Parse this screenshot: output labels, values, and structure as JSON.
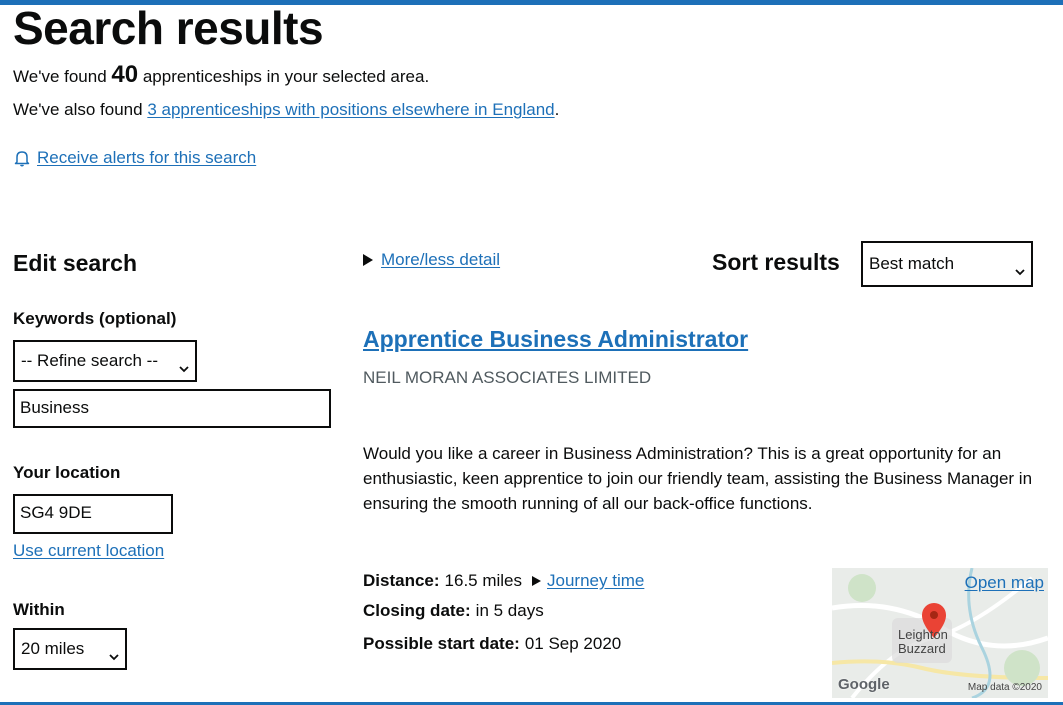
{
  "header": {
    "title": "Search results",
    "found_prefix": "We've found",
    "found_count": "40",
    "found_suffix": "apprenticeships in your selected area.",
    "also_prefix": "We've also found",
    "also_link": "3 apprenticeships with positions elsewhere in England",
    "also_suffix": ".",
    "alerts_link": "Receive alerts for this search",
    "alerts_icon": "bell-icon"
  },
  "sidebar": {
    "heading": "Edit search",
    "keywords_label": "Keywords (optional)",
    "refine_select_value": "-- Refine search --",
    "keywords_value": "Business",
    "location_label": "Your location",
    "location_value": "SG4 9DE",
    "use_location_link": "Use current location",
    "within_label": "Within",
    "within_value": "20 miles"
  },
  "results": {
    "details_toggle": "More/less detail",
    "sort_label": "Sort results",
    "sort_value": "Best match",
    "items": [
      {
        "title": "Apprentice Business Administrator",
        "employer": "NEIL MORAN ASSOCIATES LIMITED",
        "description": "Would you like a career in Business Administration? This is a great opportunity for an enthusiastic, keen apprentice to join our friendly team, assisting the Business Manager in ensuring the smooth running of all our back-office functions.",
        "distance_label": "Distance:",
        "distance_value": "16.5 miles",
        "journey_link": "Journey time",
        "closing_label": "Closing date:",
        "closing_value": "in 5 days",
        "start_label": "Possible start date:",
        "start_value": "01 Sep 2020",
        "map": {
          "open_link": "Open map",
          "place": "Leighton Buzzard",
          "logo": "Google",
          "credit": "Map data ©2020"
        }
      }
    ]
  },
  "colors": {
    "link": "#1d70b8",
    "text": "#0b0c0c",
    "secondary_text": "#505a5f",
    "pin": "#e53935"
  }
}
